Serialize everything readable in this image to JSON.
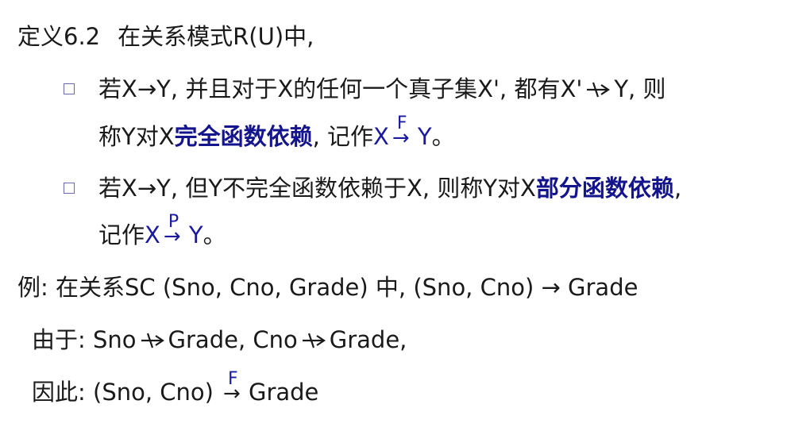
{
  "definition": {
    "label": "定义6.2",
    "text": "在关系模式R(U)中,"
  },
  "bullet1": {
    "p1": "若X→Y, 并且对于X的任何一个真子集X', 都有X'",
    "p2": "Y, 则",
    "p3": "称Y对X",
    "term": "完全函数依赖",
    "p4": ", 记作",
    "x": "X",
    "arrow_label": "F",
    "y": "Y",
    "end": "。"
  },
  "bullet2": {
    "p1": "若X→Y, 但Y不完全函数依赖于X, 则称Y对X",
    "term": "部分函数依赖",
    "p2": ",",
    "p3": "记作",
    "x": "X",
    "arrow_label": "P",
    "y": "Y",
    "end": "。"
  },
  "example": {
    "intro": "例: 在关系SC (Sno, Cno, Grade) 中, (Sno, Cno) → Grade",
    "because_label": "由于: ",
    "sno": "Sno",
    "grade1": "Grade, ",
    "cno": "Cno",
    "grade2": "Grade,",
    "therefore_label": "因此: ",
    "pair": "(Sno, Cno)",
    "arrow_label": "F",
    "grade3": "Grade"
  },
  "colors": {
    "accent": "#14148c",
    "bullet": "#6a6ab0"
  }
}
